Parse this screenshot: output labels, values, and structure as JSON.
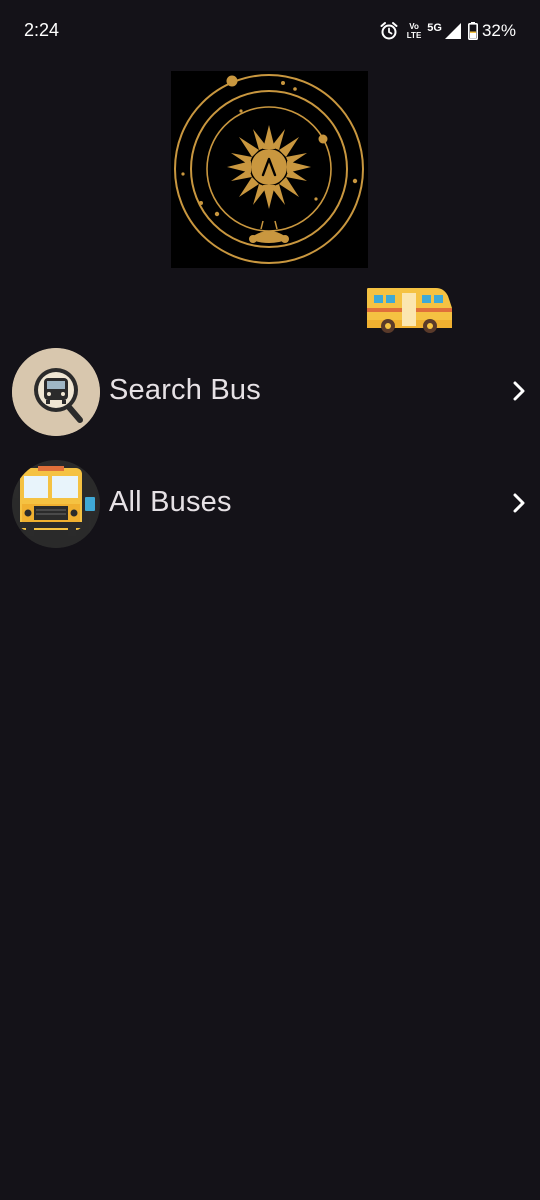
{
  "status_bar": {
    "time": "2:24",
    "volte_top": "Vo",
    "volte_bottom": "LTE",
    "network": "5G",
    "battery": "32%",
    "icons": [
      "alarm-icon",
      "volte-icon",
      "signal-icon",
      "battery-icon"
    ]
  },
  "logo": {
    "icon": "sun-compass-logo",
    "colors": {
      "background": "#000000",
      "gold": "#c9973f"
    }
  },
  "banner_icon": "bus-icon",
  "menu": [
    {
      "label": "Search Bus",
      "icon": "bus-search-icon",
      "chevron": "chevron-right-icon"
    },
    {
      "label": "All Buses",
      "icon": "school-bus-icon",
      "chevron": "chevron-right-icon"
    }
  ],
  "colors": {
    "background": "#141218",
    "text": "#e6e1e5",
    "bus_yellow": "#f5c242",
    "bus_orange": "#e0703a"
  }
}
